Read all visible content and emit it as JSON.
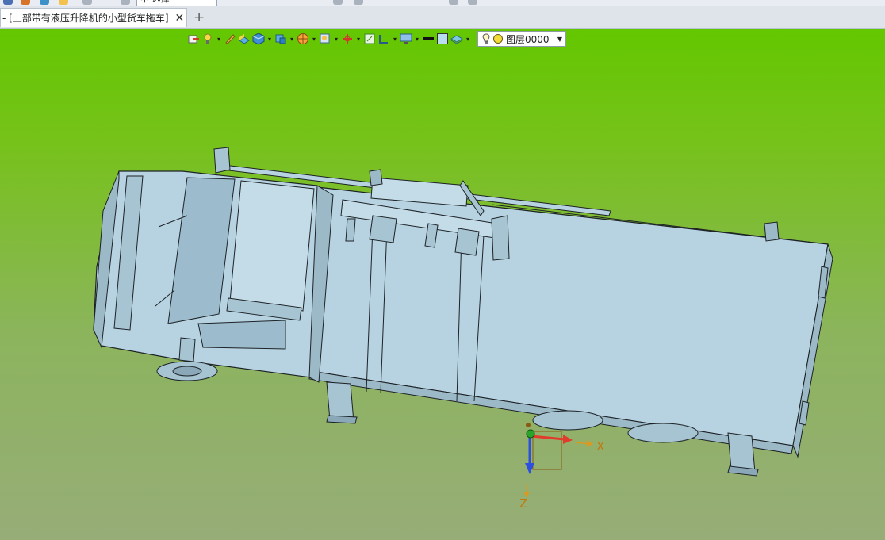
{
  "window": {
    "active_tab": "- [上部带有液压升降机的小型货车拖车]",
    "close_glyph": "✕",
    "add_tab_glyph": "+"
  },
  "top_toolbar": {
    "field_text": "中 选择"
  },
  "viewport_toolbar": {
    "icons": [
      "export-icon",
      "light-icon",
      "pen-icon",
      "shade-icon",
      "cube-icon",
      "view-cube-icon",
      "render-sphere-icon",
      "zoom-fit-icon",
      "axis-icon",
      "grid-icon",
      "dimension-icon",
      "display-icon",
      "line-color-icon",
      "fill-color-icon",
      "layer-stack-icon"
    ],
    "layer_name": "图层0000"
  },
  "triad": {
    "x_label": "X",
    "z_label": "Z",
    "colors": {
      "x": "#e23a2b",
      "y": "#2aa52a",
      "z": "#2b4fe0"
    }
  },
  "colors": {
    "model": "#b7d3e1",
    "model_shadow": "#9cb9c8",
    "outline": "#1d2226",
    "background_top": "#63c700",
    "background_bottom": "#97ad78"
  }
}
